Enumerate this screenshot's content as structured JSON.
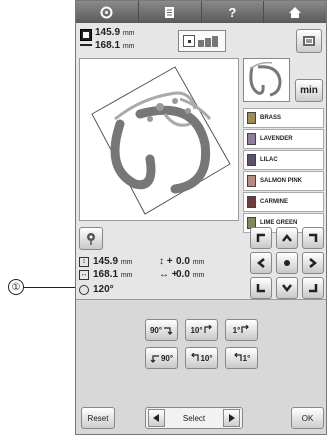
{
  "callout": {
    "number": "①"
  },
  "topbar": {
    "help_label": "?"
  },
  "info": {
    "width": "145.9",
    "height": "168.1",
    "unit": "mm"
  },
  "min_label": "min",
  "colors": [
    {
      "name": "BRASS",
      "hex": "#9e8a5a"
    },
    {
      "name": "LAVENDER",
      "hex": "#8d7f9a"
    },
    {
      "name": "LILAC",
      "hex": "#5e4f6a"
    },
    {
      "name": "SALMON PINK",
      "hex": "#b58a80"
    },
    {
      "name": "CARMINE",
      "hex": "#6c3c40"
    },
    {
      "name": "LIME GREEN",
      "hex": "#7a8a5e"
    }
  ],
  "readouts": {
    "height": "145.9",
    "width": "168.1",
    "unit": "mm",
    "offset_v": "0.0",
    "offset_h": "0.0",
    "offset_plus_v": "+",
    "offset_plus_h": "+",
    "rotation": "120°"
  },
  "rotate": {
    "cw90": "90°",
    "cw10": "10°",
    "cw1": "1°",
    "ccw90": "90°",
    "ccw10": "10°",
    "ccw1": "1°"
  },
  "reset_label": "Reset",
  "select_label": "Select",
  "ok_label": "OK"
}
